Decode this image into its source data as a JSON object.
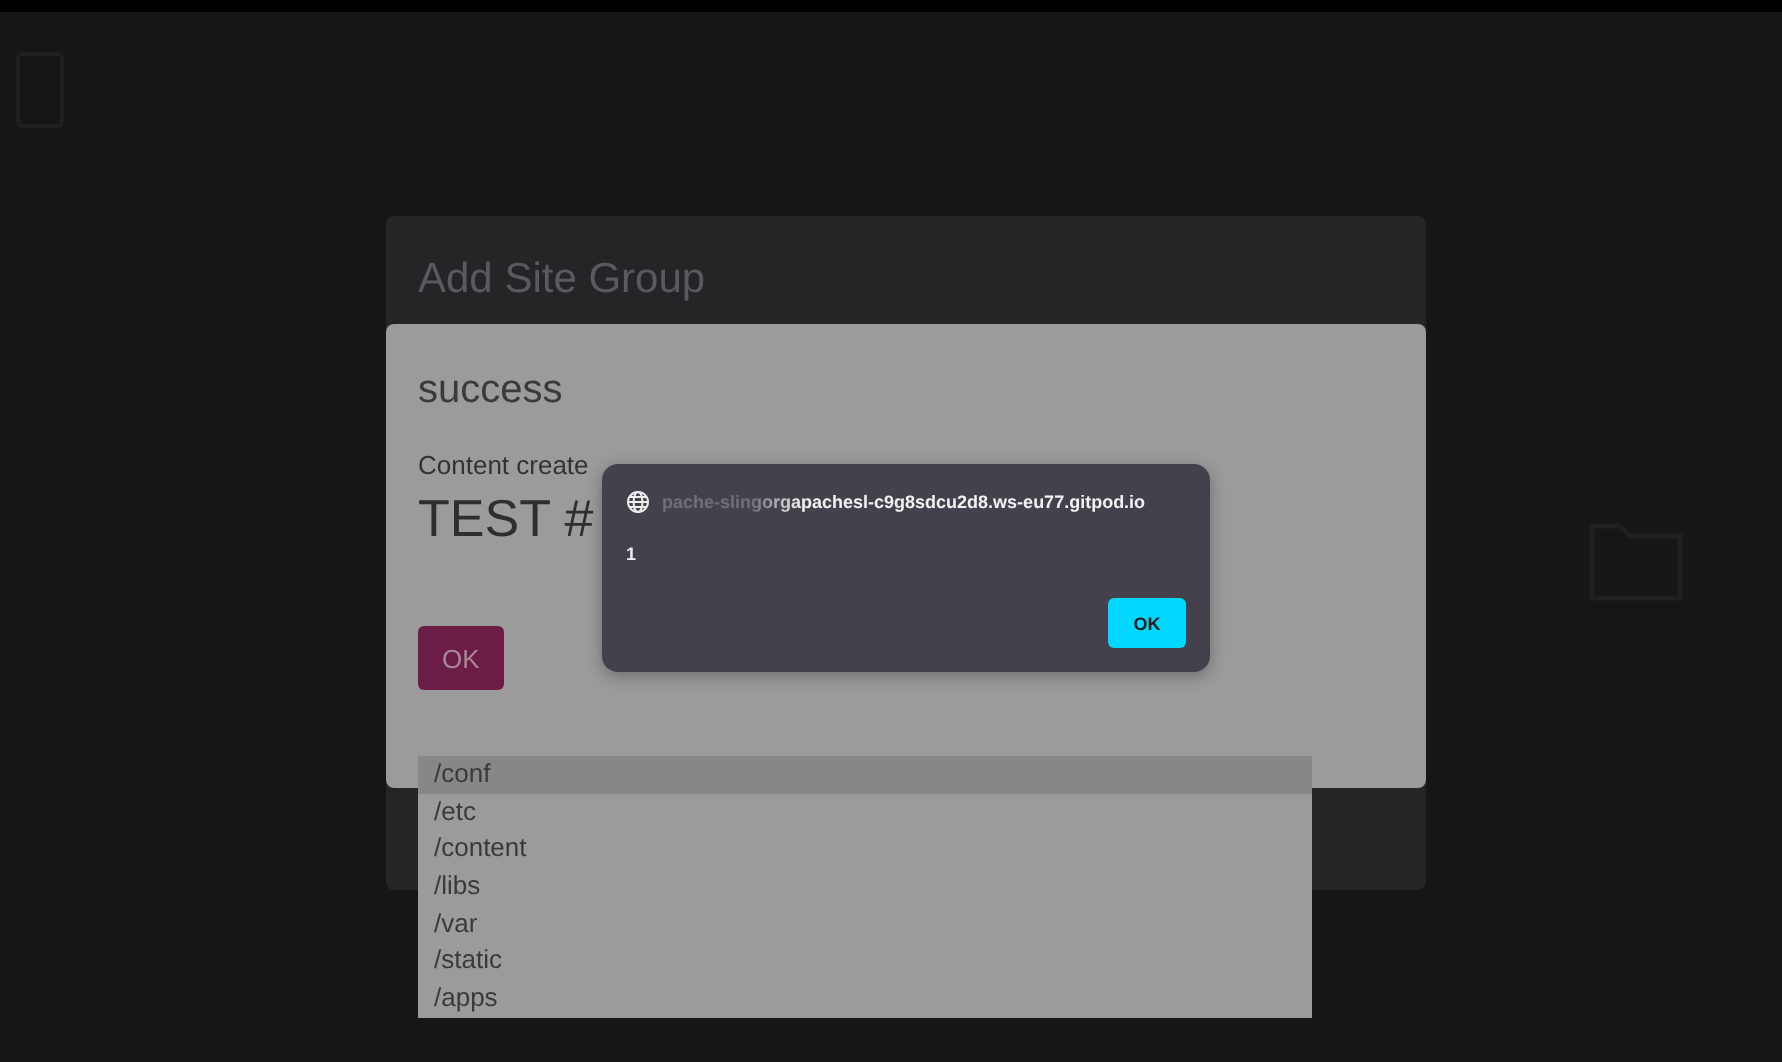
{
  "background_dialog": {
    "title": "Add Site Group"
  },
  "success_dialog": {
    "title": "success",
    "message": "Content create",
    "heading": "TEST #",
    "ok_button": "OK"
  },
  "alert": {
    "origin": "pache-slingorgapachesl-c9g8sdcu2d8.ws-eu77.gitpod.io",
    "message": "1",
    "ok_button": "OK"
  },
  "dropdown": {
    "items": [
      {
        "label": "/conf",
        "selected": true
      },
      {
        "label": "/etc",
        "selected": false
      },
      {
        "label": "/content",
        "selected": false
      },
      {
        "label": "/libs",
        "selected": false
      },
      {
        "label": "/var",
        "selected": false
      },
      {
        "label": "/static",
        "selected": false
      },
      {
        "label": "/apps",
        "selected": false
      }
    ]
  }
}
